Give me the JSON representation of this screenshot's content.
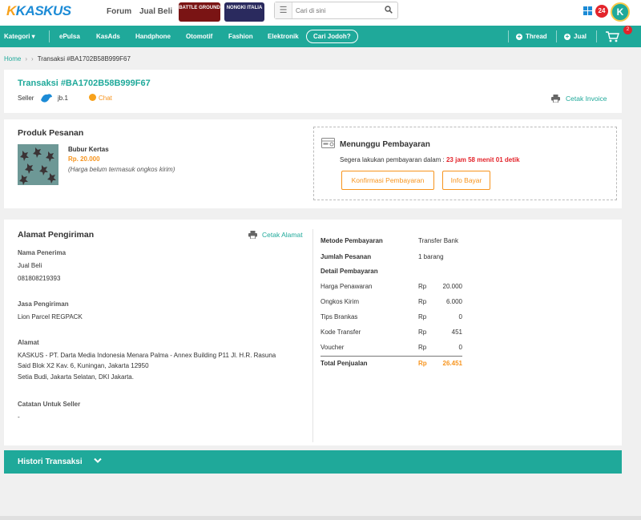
{
  "brand": {
    "logo_main": "KASKUS",
    "logo_mark": "K"
  },
  "header": {
    "nav": [
      "Forum",
      "Jual Beli"
    ],
    "badges": [
      "BATTLE GROUND",
      "NONGKI ITALIA"
    ],
    "search_placeholder": "Cari di sini",
    "notif_count": "24",
    "avatar_letter": "K"
  },
  "catbar": {
    "kategori": "Kategori",
    "items": [
      "ePulsa",
      "KasAds",
      "Handphone",
      "Otomotif",
      "Fashion",
      "Elektronik"
    ],
    "pill": "Cari Jodoh?",
    "thread": "Thread",
    "jual": "Jual",
    "cart_count": "2"
  },
  "breadcrumb": {
    "home": "Home",
    "current": "Transaksi #BA1702B58B999F67"
  },
  "transaction": {
    "title": "Transaksi #BA1702B58B999F67",
    "seller_label": "Seller",
    "seller_name": "jb.1",
    "chat": "Chat",
    "print_invoice": "Cetak Invoice"
  },
  "product": {
    "section_title": "Produk Pesanan",
    "name": "Bubur Kertas",
    "price": "Rp. 20.000",
    "note": "(Harga belum termasuk ongkos kirim)"
  },
  "payment_status": {
    "title": "Menunggu Pembayaran",
    "deadline_text": "Segera lakukan pembayaran dalam : ",
    "deadline_time": "23 jam 58 menit 01 detik",
    "confirm_button": "Konfirmasi Pembayaran",
    "info_button": "Info Bayar"
  },
  "shipping": {
    "section_title": "Alamat Pengiriman",
    "print_address": "Cetak Alamat",
    "recipient_label": "Nama Penerima",
    "recipient_name": "Jual Beli",
    "recipient_phone": "081808219393",
    "courier_label": "Jasa Pengiriman",
    "courier": "Lion Parcel REGPACK",
    "address_label": "Alamat",
    "address_line1": "KASKUS - PT. Darta Media Indonesia Menara Palma - Annex Building P11 Jl. H.R. Rasuna",
    "address_line2": "Said Blok X2 Kav. 6, Kuningan, Jakarta 12950",
    "address_line3": "Setia Budi, Jakarta Selatan, DKI Jakarta.",
    "note_label": "Catatan Untuk Seller",
    "note_value": "-"
  },
  "payment_detail": {
    "method_label": "Metode Pembayaran",
    "method_value": "Transfer Bank",
    "qty_label": "Jumlah Pesanan",
    "qty_value": "1 barang",
    "detail_label": "Detail Pembayaran",
    "currency": "Rp",
    "rows": [
      {
        "label": "Harga Penawaran",
        "value": "20.000"
      },
      {
        "label": "Ongkos Kirim",
        "value": "6.000"
      },
      {
        "label": "Tips Brankas",
        "value": "0"
      },
      {
        "label": "Kode Transfer",
        "value": "451"
      },
      {
        "label": "Voucher",
        "value": "0"
      }
    ],
    "total_label": "Total Penjualan",
    "total_value": "26.451"
  },
  "history": {
    "title": "Histori Transaksi"
  },
  "colors": {
    "primary": "#1fa99a",
    "accent": "#f7941d",
    "danger": "#e3242b",
    "brand_blue": "#1c8bd6"
  }
}
